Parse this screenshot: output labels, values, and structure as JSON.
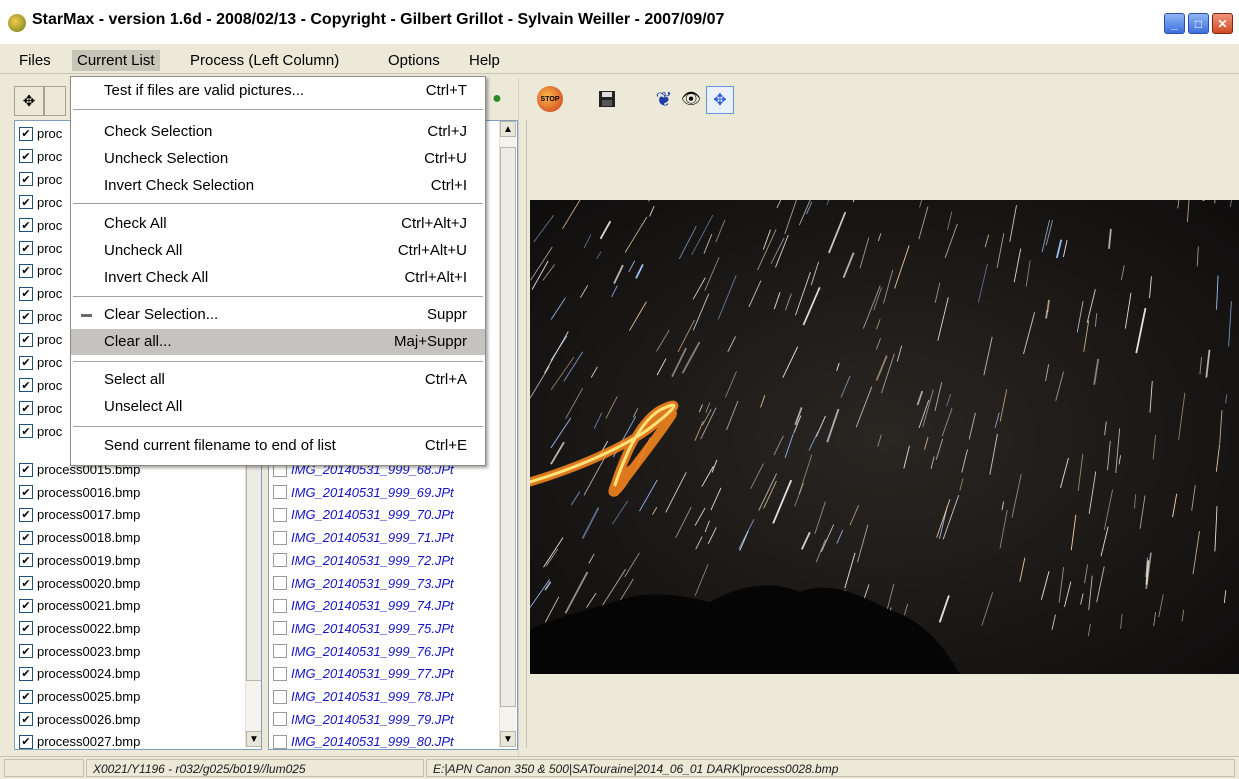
{
  "window": {
    "title": "StarMax - version 1.6d - 2008/02/13 - Copyright - Gilbert Grillot - Sylvain Weiller - 2007/09/07",
    "minimize_icon": "minimize-icon",
    "maximize_icon": "maximize-icon",
    "close_icon": "close-icon"
  },
  "menubar": {
    "files": "Files",
    "current_list": "Current List",
    "process": "Process (Left Column)",
    "options": "Options",
    "help": "Help"
  },
  "dropdown": {
    "items": [
      {
        "label": "Test if files are valid pictures...",
        "shortcut": "Ctrl+T"
      },
      {
        "label": "Check Selection",
        "shortcut": "Ctrl+J"
      },
      {
        "label": "Uncheck Selection",
        "shortcut": "Ctrl+U"
      },
      {
        "label": "Invert Check Selection",
        "shortcut": "Ctrl+I"
      },
      {
        "label": "Check All",
        "shortcut": "Ctrl+Alt+J"
      },
      {
        "label": "Uncheck All",
        "shortcut": "Ctrl+Alt+U"
      },
      {
        "label": "Invert Check All",
        "shortcut": "Ctrl+Alt+I"
      },
      {
        "label": "Clear Selection...",
        "shortcut": "Suppr"
      },
      {
        "label": "Clear all...",
        "shortcut": "Maj+Suppr"
      },
      {
        "label": "Select all",
        "shortcut": "Ctrl+A"
      },
      {
        "label": "Unselect All",
        "shortcut": ""
      },
      {
        "label": "Send current filename to end of list",
        "shortcut": "Ctrl+E"
      }
    ]
  },
  "left_list": {
    "prefix": "proc",
    "visible_files": [
      "process0015.bmp",
      "process0016.bmp",
      "process0017.bmp",
      "process0018.bmp",
      "process0019.bmp",
      "process0020.bmp",
      "process0021.bmp",
      "process0022.bmp",
      "process0023.bmp",
      "process0024.bmp",
      "process0025.bmp",
      "process0026.bmp",
      "process0027.bmp"
    ]
  },
  "mid_list": {
    "visible_files": [
      "IMG_20140531_999_68.JPt",
      "IMG_20140531_999_69.JPt",
      "IMG_20140531_999_70.JPt",
      "IMG_20140531_999_71.JPt",
      "IMG_20140531_999_72.JPt",
      "IMG_20140531_999_73.JPt",
      "IMG_20140531_999_74.JPt",
      "IMG_20140531_999_75.JPt",
      "IMG_20140531_999_76.JPt",
      "IMG_20140531_999_77.JPt",
      "IMG_20140531_999_78.JPt",
      "IMG_20140531_999_79.JPt",
      "IMG_20140531_999_80.JPt"
    ]
  },
  "toolbar": {
    "stop_label": "STOP"
  },
  "status": {
    "coords": "X0021/Y1196 - r032/g025/b019//lum025",
    "path": "E:|APN Canon 350 & 500|SATouraine|2014_06_01 DARK|process0028.bmp"
  }
}
